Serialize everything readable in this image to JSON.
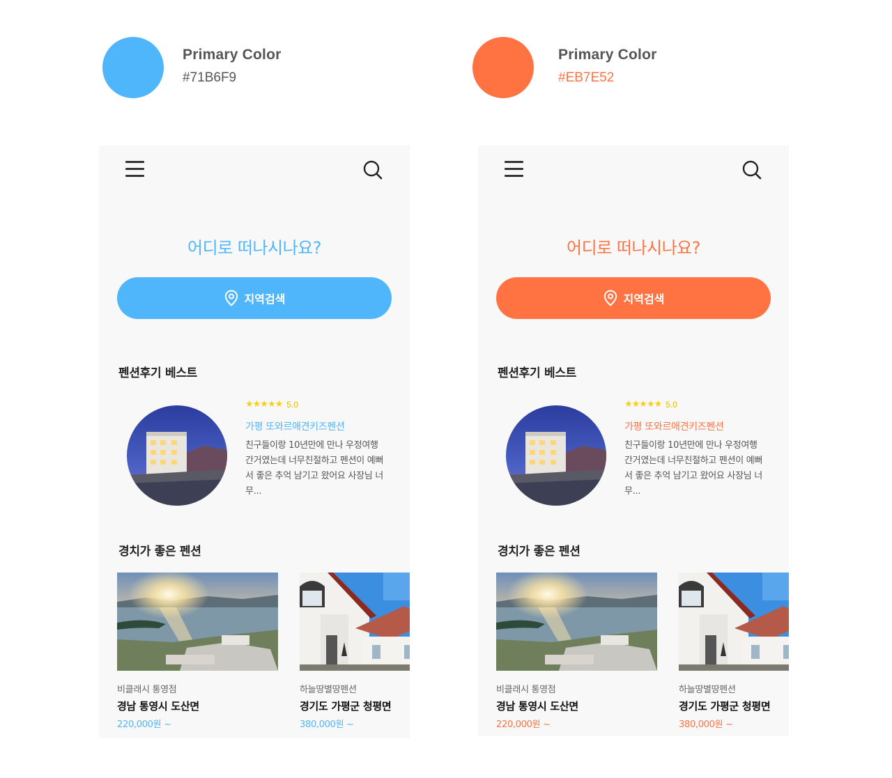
{
  "themes": [
    {
      "id": "blue",
      "accent": "#4FB6FB",
      "swatch_label": "Primary Color",
      "swatch_hex": "#71B6F9",
      "hex_text_color": "#555555",
      "headline": "어디로 떠나시나요?",
      "search_button_label": "지역검색",
      "best_section_title": "펜션후기 베스트",
      "review": {
        "stars": "★★★★★",
        "score": "5.0",
        "name": "가평 또와르애견키즈펜션",
        "text": "친구들이랑 10년만에 만나 우정여행 간거였는데 너무친절하고 펜션이 예뻐서 좋은 추억 남기고 왔어요 사장님 너무..."
      },
      "scenic_section_title": "경치가 좋은 펜션",
      "cards": [
        {
          "subtitle": "비클래시 통영점",
          "location": "경남 통영시 도산면",
          "price": "220,000원 ~"
        },
        {
          "subtitle": "하늘땅별땅펜션",
          "location": "경기도 가평군 청평면",
          "price": "380,000원 ~"
        }
      ]
    },
    {
      "id": "orange",
      "accent": "#FF7343",
      "swatch_label": "Primary Color",
      "swatch_hex": "#EB7E52",
      "hex_text_color": "#FF7343",
      "headline": "어디로 떠나시나요?",
      "search_button_label": "지역검색",
      "best_section_title": "펜션후기 베스트",
      "review": {
        "stars": "★★★★★",
        "score": "5.0",
        "name": "가평 또와르애견키즈펜션",
        "text": "친구들이랑 10년만에 만나 우정여행 간거였는데 너무친절하고 펜션이 예뻐서 좋은 추억 남기고 왔어요 사장님 너무..."
      },
      "scenic_section_title": "경치가 좋은 펜션",
      "cards": [
        {
          "subtitle": "비클래시 통영점",
          "location": "경남 통영시 도산면",
          "price": "220,000원 ~"
        },
        {
          "subtitle": "하늘땅별땅펜션",
          "location": "경기도 가평군 청평면",
          "price": "380,000원 ~"
        }
      ]
    }
  ],
  "icons": {
    "menu": "hamburger-menu-icon",
    "search": "search-icon",
    "pin": "location-pin-icon",
    "star": "star-icon"
  }
}
